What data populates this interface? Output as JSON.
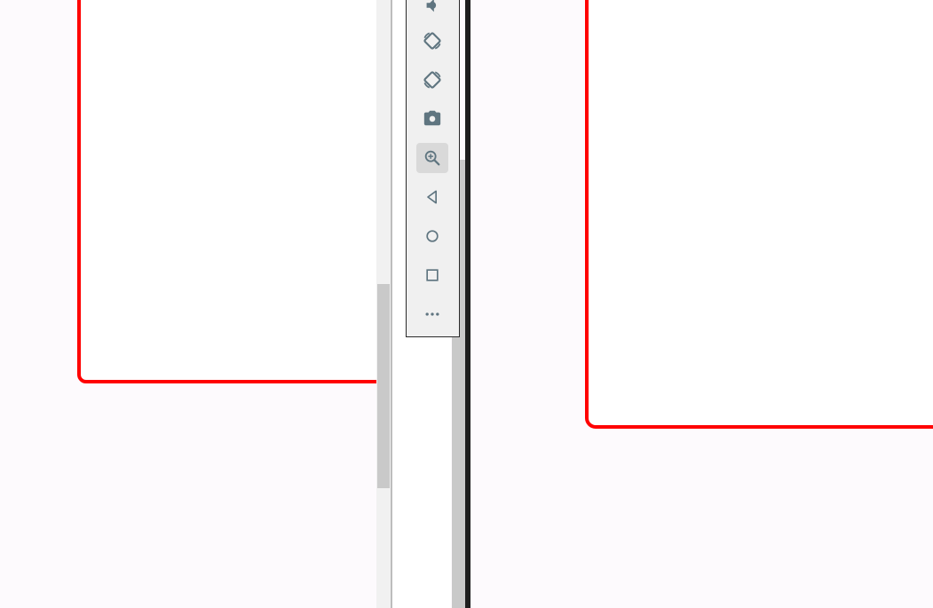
{
  "colors": {
    "card_border": "#ff0000",
    "toolbar_icon": "#5f7580",
    "toolbar_bg": "#f0f0f0",
    "page_bg": "#fdfafd"
  },
  "toolbar": {
    "buttons": [
      {
        "icon": "volume-down-icon",
        "active": false
      },
      {
        "icon": "rotate-left-icon",
        "active": false
      },
      {
        "icon": "rotate-right-icon",
        "active": false
      },
      {
        "icon": "camera-icon",
        "active": false
      },
      {
        "icon": "zoom-icon",
        "active": true
      },
      {
        "icon": "back-icon",
        "active": false
      },
      {
        "icon": "home-icon",
        "active": false
      },
      {
        "icon": "overview-icon",
        "active": false
      },
      {
        "icon": "more-icon",
        "active": false
      }
    ]
  }
}
